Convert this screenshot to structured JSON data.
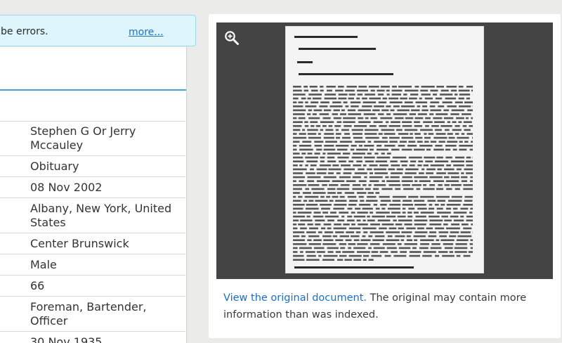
{
  "notice": {
    "text": "be errors.",
    "more_link": "more..."
  },
  "record": {
    "rows": [
      {
        "value": "Stephen G Or Jerry Mccauley"
      },
      {
        "value": "Obituary"
      },
      {
        "value": "08 Nov 2002"
      },
      {
        "value": "Albany, New York, United States"
      },
      {
        "value": "Center Brunswick"
      },
      {
        "value": "Male"
      },
      {
        "value": "66"
      },
      {
        "value": "Foreman, Bartender, Officer"
      },
      {
        "value": "30 Nov 1935"
      }
    ]
  },
  "viewer": {
    "zoom_icon": "zoom-in-icon"
  },
  "caption": {
    "link_text": "View the original document.",
    "text": " The original may contain more information than was indexed."
  },
  "colors": {
    "accent": "#3ba4d8",
    "link": "#1a6fc4",
    "viewer_bg": "#444444",
    "notice_bg": "#def5fb"
  }
}
